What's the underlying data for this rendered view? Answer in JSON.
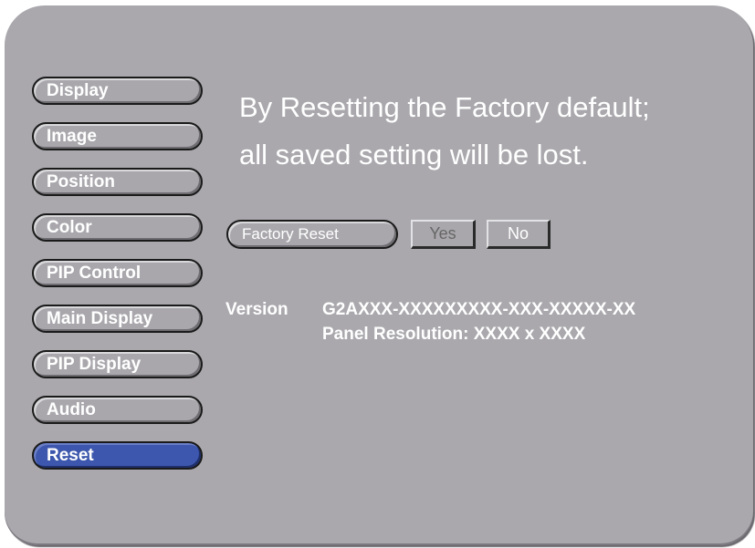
{
  "sidebar": {
    "items": [
      {
        "label": "Display"
      },
      {
        "label": "Image"
      },
      {
        "label": "Position"
      },
      {
        "label": "Color"
      },
      {
        "label": "PIP Control"
      },
      {
        "label": "Main Display"
      },
      {
        "label": "PIP Display"
      },
      {
        "label": "Audio"
      },
      {
        "label": "Reset",
        "active": true
      }
    ]
  },
  "main": {
    "message_line1": "By Resetting the Factory default;",
    "message_line2": "all saved setting will be lost.",
    "factory_reset_label": "Factory Reset",
    "yes_label": "Yes",
    "no_label": "No",
    "version_label": "Version",
    "version_value": "G2AXXX-XXXXXXXXX-XXX-XXXXX-XX",
    "panel_resolution": "Panel Resolution: XXXX x XXXX"
  },
  "colors": {
    "panel_bg": "#aaa8ad",
    "active_item": "#3c57ad",
    "text": "#ffffff",
    "disabled_text": "#666666"
  }
}
